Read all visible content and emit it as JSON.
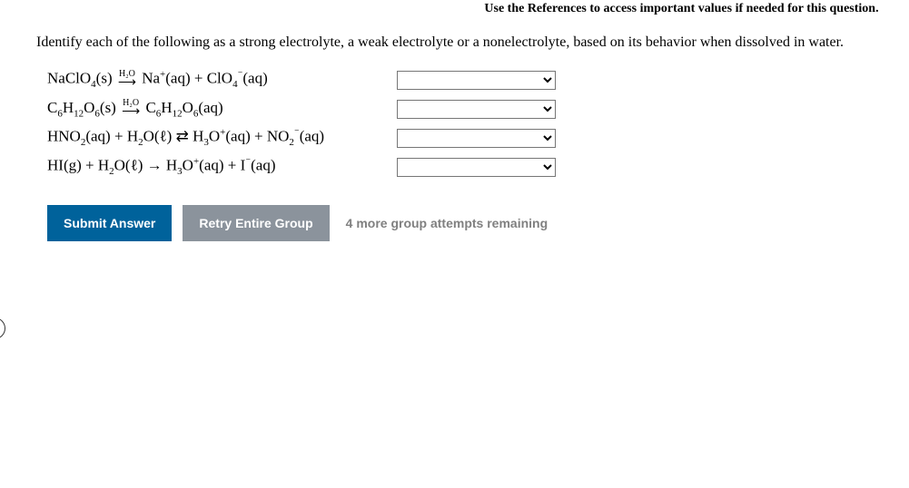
{
  "references_note": "Use the References to access important values if needed for this question.",
  "question_text": "Identify each of the following as a strong electrolyte, a weak electrolyte or a nonelectrolyte, based on its behavior when dissolved in water.",
  "equations": {
    "eq1": {
      "left": "NaClO",
      "left_sub": "4",
      "state1": "(s)",
      "arrow_label": "H₂O",
      "arrow": "⟶",
      "r1": "Na",
      "r1_sup": "+",
      "r1_state": "(aq)",
      "plus": "+",
      "r2": "ClO",
      "r2_sub": "4",
      "r2_sup": "⁻",
      "r2_state": "(aq)"
    },
    "eq2": {
      "l1": "C",
      "l1_sub": "6",
      "l2": "H",
      "l2_sub": "12",
      "l3": "O",
      "l3_sub": "6",
      "state1": "(s)",
      "arrow_label": "H₂O",
      "arrow": "⟶",
      "r1": "C",
      "r1_sub": "6",
      "r2": "H",
      "r2_sub": "12",
      "r3": "O",
      "r3_sub": "6",
      "r_state": "(aq)"
    },
    "eq3": {
      "l1": "HNO",
      "l1_sub": "2",
      "l1_state": "(aq)",
      "plus1": "+",
      "l2": "H",
      "l2_sub": "2",
      "l3": "O(ℓ)",
      "arrow": "⇄",
      "r1": "H",
      "r1_sub": "3",
      "r2": "O",
      "r2_sup": "+",
      "r2_state": "(aq)",
      "plus2": "+",
      "r3": "NO",
      "r3_sub": "2",
      "r3_sup": "⁻",
      "r3_state": "(aq)"
    },
    "eq4": {
      "l1": "HI(g)",
      "plus1": "+",
      "l2": "H",
      "l2_sub": "2",
      "l3": "O(ℓ)",
      "arrow": "→",
      "r1": "H",
      "r1_sub": "3",
      "r2": "O",
      "r2_sup": "+",
      "r2_state": "(aq)",
      "plus2": "+",
      "r3": "I",
      "r3_sup": "⁻",
      "r3_state": "(aq)"
    }
  },
  "buttons": {
    "submit": "Submit Answer",
    "retry": "Retry Entire Group"
  },
  "attempts_text": "4 more group attempts remaining"
}
